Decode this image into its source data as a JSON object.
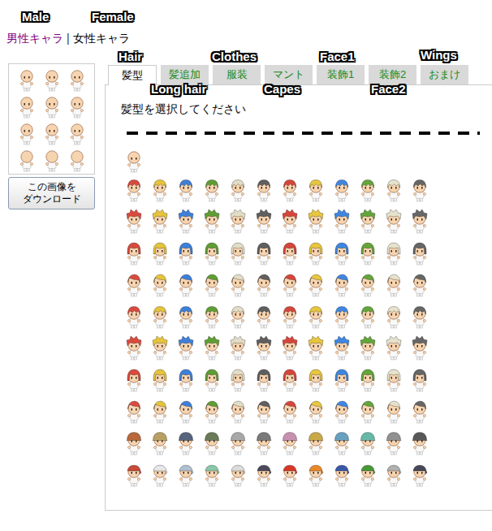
{
  "annotations": {
    "male": "Male",
    "female": "Female",
    "hair": "Hair",
    "long_hair": "Long hair",
    "clothes": "Clothes",
    "capes": "Capes",
    "face1": "Face1",
    "face2": "Face2",
    "wings": "Wings"
  },
  "gender_tabs": [
    {
      "label": "男性キャラ",
      "selected": true
    },
    {
      "label": "女性キャラ",
      "selected": false
    }
  ],
  "separator": "|",
  "download_button": {
    "lines": [
      "この画像を",
      "ダウンロード"
    ]
  },
  "tabs": [
    {
      "label": "髪型",
      "selected": true
    },
    {
      "label": "髪追加",
      "selected": false
    },
    {
      "label": "服装",
      "selected": false
    },
    {
      "label": "マント",
      "selected": false
    },
    {
      "label": "装飾1",
      "selected": false
    },
    {
      "label": "装飾2",
      "selected": false
    },
    {
      "label": "おまけ",
      "selected": false
    }
  ],
  "instruction": "髪型を選択してください",
  "hair_rows": [
    [
      "#d94a3e",
      "#e6c43a",
      "#3e7fd9",
      "#5e9e34",
      "#e2ddc6",
      "#5f5f5f",
      "#d6453c",
      "#e8c63e",
      "#3f86e0",
      "#63a53a",
      "#e7e2cc",
      "#666666"
    ],
    [
      "#d94a3e",
      "#e6c43a",
      "#3e7fd9",
      "#5e9e34",
      "#e2ddc6",
      "#5f5f5f",
      "#d6453c",
      "#e8c63e",
      "#3f86e0",
      "#63a53a",
      "#e7e2cc",
      "#666666"
    ],
    [
      "#d94a3e",
      "#e6c43a",
      "#3e7fd9",
      "#5e9e34",
      "#e2ddc6",
      "#5f5f5f",
      "#d6453c",
      "#e8c63e",
      "#3f86e0",
      "#63a53a",
      "#e7e2cc",
      "#666666"
    ],
    [
      "#d94a3e",
      "#e6c43a",
      "#3e7fd9",
      "#5e9e34",
      "#e2ddc6",
      "#5f5f5f",
      "#d6453c",
      "#e8c63e",
      "#3f86e0",
      "#63a53a",
      "#e7e2cc",
      "#666666"
    ],
    [
      "#d94a3e",
      "#e6c43a",
      "#3e7fd9",
      "#5e9e34",
      "#e2ddc6",
      "#5f5f5f",
      "#d6453c",
      "#e8c63e",
      "#3f86e0",
      "#63a53a",
      "#e7e2cc",
      "#666666"
    ],
    [
      "#d94a3e",
      "#e6c43a",
      "#3e7fd9",
      "#5e9e34",
      "#e2ddc6",
      "#5f5f5f",
      "#d6453c",
      "#e8c63e",
      "#3f86e0",
      "#63a53a",
      "#e7e2cc",
      "#666666"
    ],
    [
      "#d94a3e",
      "#e6c43a",
      "#3e7fd9",
      "#5e9e34",
      "#e2ddc6",
      "#5f5f5f",
      "#d6453c",
      "#e8c63e",
      "#3f86e0",
      "#63a53a",
      "#e7e2cc",
      "#666666"
    ],
    [
      "#d94a3e",
      "#e6c43a",
      "#3e7fd9",
      "#5e9e34",
      "#e2ddc6",
      "#5f5f5f",
      "#d6453c",
      "#e8c63e",
      "#3f86e0",
      "#63a53a",
      "#e7e2cc",
      "#666666"
    ],
    [
      "#b8683a",
      "#b8a064",
      "#58647c",
      "#6a7a58",
      "#a8a8a8",
      "#7a7a7a",
      "#c890b0",
      "#c8a848",
      "#68a0c0",
      "#68b8a8",
      "#909090",
      "#585858"
    ],
    [
      "#c84a3a",
      "#e8e8e8",
      "#b0c0d0",
      "#88c8a8",
      "#dcdcdc",
      "#4a4a5a",
      "#d83828",
      "#e88828",
      "#3858a8",
      "#489838",
      "#b0b0b0",
      "#484858"
    ]
  ]
}
